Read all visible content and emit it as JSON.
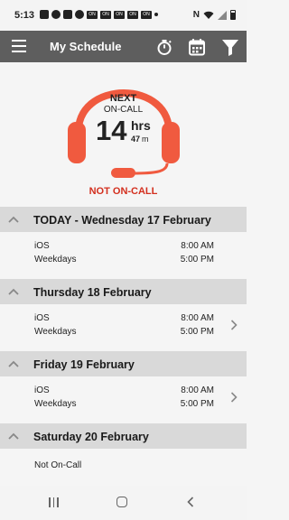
{
  "status_bar": {
    "time": "5:13",
    "on_badges": [
      "ON",
      "ON",
      "ON",
      "ON",
      "ON"
    ]
  },
  "app_bar": {
    "title": "My Schedule",
    "actions": [
      "stopwatch-icon",
      "calendar-icon",
      "filter-icon"
    ]
  },
  "countdown": {
    "next_label": "NEXT",
    "oncall_label": "ON-CALL",
    "hours": "14",
    "hours_unit": "hrs",
    "minutes": "47",
    "minutes_unit": "m",
    "status": "NOT ON-CALL",
    "accent_color": "#f05a3f"
  },
  "days": [
    {
      "title": "TODAY - Wednesday 17 February",
      "shift": "iOS",
      "days": "Weekdays",
      "start": "8:00 AM",
      "end": "5:00 PM",
      "has_chevron": false
    },
    {
      "title": "Thursday 18 February",
      "shift": "iOS",
      "days": "Weekdays",
      "start": "8:00 AM",
      "end": "5:00 PM",
      "has_chevron": true
    },
    {
      "title": "Friday 19 February",
      "shift": "iOS",
      "days": "Weekdays",
      "start": "8:00 AM",
      "end": "5:00 PM",
      "has_chevron": true
    },
    {
      "title": "Saturday 20 February",
      "none": "Not On-Call"
    }
  ],
  "colors": {
    "app_bar": "#5e5e5e",
    "header_bg": "#d9d9d9",
    "status_red": "#d32f1e"
  }
}
